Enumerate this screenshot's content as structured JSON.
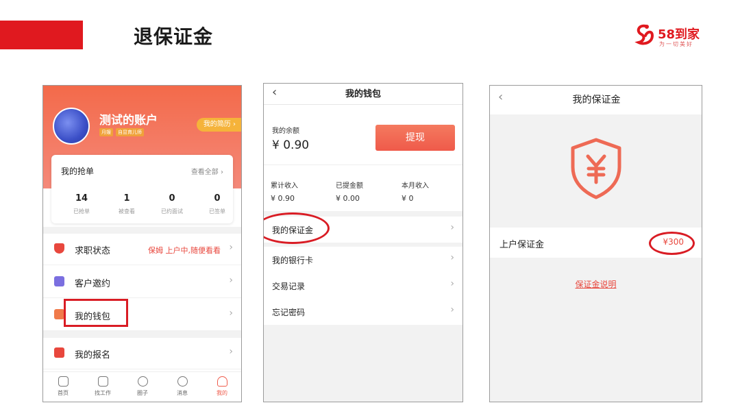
{
  "slide": {
    "title": "退保证金",
    "logo_text": "58到家",
    "logo_tagline": "为一切美好",
    "accent_color": "#e0191f"
  },
  "profile_screen": {
    "account_name": "测试的账户",
    "tags": [
      "月嫂",
      "自显育儿师"
    ],
    "resume_button": "我的简历 ›",
    "orders": {
      "title": "我的抢单",
      "view_all": "查看全部 ›",
      "stats": [
        {
          "value": "14",
          "label": "已抢单"
        },
        {
          "value": "1",
          "label": "被查看"
        },
        {
          "value": "0",
          "label": "已约面试"
        },
        {
          "value": "0",
          "label": "已签单"
        }
      ]
    },
    "menu": [
      {
        "label": "求职状态",
        "extra": "保姆  上户中,随便看看",
        "icon": "shield-icon",
        "icon_color": "#e8473d"
      },
      {
        "label": "客户邀约",
        "extra": "",
        "icon": "mail-icon",
        "icon_color": "#7b6fe0"
      },
      {
        "label": "我的钱包",
        "extra": "",
        "icon": "wallet-icon",
        "icon_color": "#f07a4a"
      },
      {
        "label": "我的报名",
        "extra": "",
        "icon": "signup-icon",
        "icon_color": "#e8473d"
      }
    ],
    "tabbar": [
      {
        "label": "首页",
        "icon": "home-icon"
      },
      {
        "label": "找工作",
        "icon": "job-icon"
      },
      {
        "label": "圈子",
        "icon": "circle-icon"
      },
      {
        "label": "消息",
        "icon": "message-icon"
      },
      {
        "label": "我的",
        "icon": "user-icon",
        "active": true
      }
    ]
  },
  "wallet_screen": {
    "title": "我的钱包",
    "balance_label": "我的余额",
    "balance_value": "¥ 0.90",
    "withdraw_button": "提现",
    "stats": [
      {
        "label": "累计收入",
        "value": "¥ 0.90"
      },
      {
        "label": "已提金额",
        "value": "¥ 0.00"
      },
      {
        "label": "本月收入",
        "value": "¥ 0"
      }
    ],
    "rows": [
      "我的保证金",
      "我的银行卡",
      "交易记录",
      "忘记密码"
    ]
  },
  "deposit_screen": {
    "title": "我的保证金",
    "row_label": "上户保证金",
    "row_value": "¥300",
    "link": "保证金说明"
  }
}
